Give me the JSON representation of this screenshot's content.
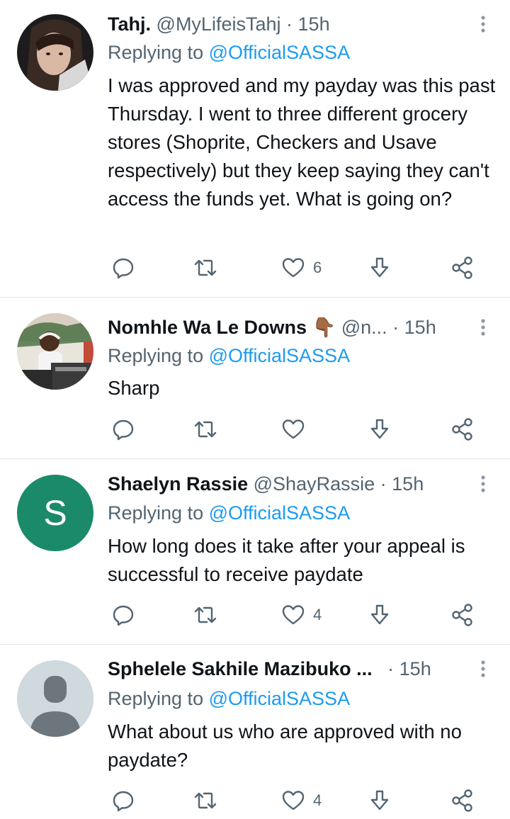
{
  "tweets": [
    {
      "name": "Tahj.",
      "handle": "@MyLifeisTahj",
      "dot": "·",
      "time": "15h",
      "replying_prefix": "Replying to ",
      "replying_to": "@OfficialSASSA",
      "text": "I was approved and my payday was this past Thursday. I went to three different grocery stores (Shoprite, Checkers and Usave respectively) but they keep saying they can't access the funds yet. What is going on?",
      "like_count": "6"
    },
    {
      "name": "Nomhle Wa Le Downs",
      "emoji": "👇🏾",
      "handle": "@n...",
      "dot": "·",
      "time": "15h",
      "replying_prefix": "Replying to ",
      "replying_to": "@OfficialSASSA",
      "text": "Sharp",
      "like_count": ""
    },
    {
      "name": "Shaelyn Rassie",
      "handle": "@ShayRassie",
      "dot": "·",
      "time": "15h",
      "avatar_letter": "S",
      "replying_prefix": "Replying to ",
      "replying_to": "@OfficialSASSA",
      "text": "How long does it take after your appeal is successful to receive paydate",
      "like_count": "4"
    },
    {
      "name": "Sphelele Sakhile Mazibuko ...",
      "handle": "",
      "dot": "·",
      "time": "15h",
      "replying_prefix": "Replying to ",
      "replying_to": "@OfficialSASSA",
      "text": "What about us who are approved with no paydate?",
      "like_count": "4"
    }
  ],
  "colors": {
    "text": "#0f1419",
    "secondary": "#536471",
    "accent": "#1d9bf0",
    "avatar_green": "#1b8a6b",
    "default_avatar_bg": "#cfd9de"
  },
  "icons": [
    "reply-icon",
    "retweet-icon",
    "like-icon",
    "bookmark-arrow-icon",
    "share-icon",
    "more-icon"
  ]
}
